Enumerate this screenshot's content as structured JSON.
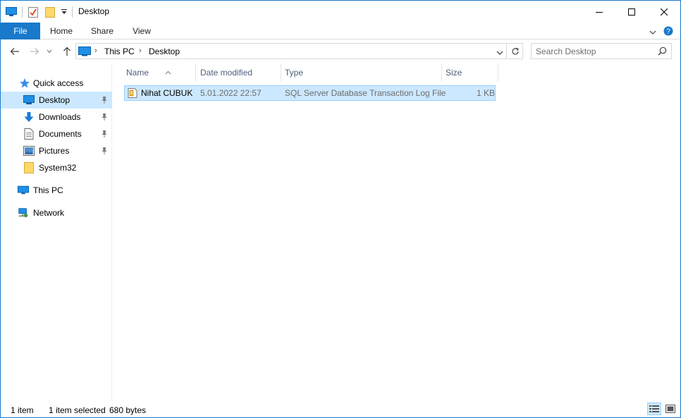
{
  "window": {
    "title": "Desktop",
    "accent": "#1979ca",
    "selection_color": "#cce8ff"
  },
  "quick_access_toolbar": {
    "icons": [
      "pc-icon",
      "properties-icon",
      "new-folder-icon",
      "customize-dropdown-icon"
    ]
  },
  "caption_buttons": [
    "minimize",
    "maximize",
    "close"
  ],
  "ribbon": {
    "tabs": [
      {
        "label": "File"
      },
      {
        "label": "Home"
      },
      {
        "label": "Share"
      },
      {
        "label": "View"
      }
    ]
  },
  "address": {
    "breadcrumbs": [
      "This PC",
      "Desktop"
    ]
  },
  "search": {
    "placeholder": "Search Desktop"
  },
  "nav": {
    "quick_access": "Quick access",
    "items": [
      {
        "label": "Desktop",
        "icon": "desktop-icon",
        "pinned": true,
        "selected": true
      },
      {
        "label": "Downloads",
        "icon": "downloads-icon",
        "pinned": true
      },
      {
        "label": "Documents",
        "icon": "documents-icon",
        "pinned": true
      },
      {
        "label": "Pictures",
        "icon": "pictures-icon",
        "pinned": true
      },
      {
        "label": "System32",
        "icon": "folder-icon",
        "pinned": false
      }
    ],
    "this_pc": "This PC",
    "network": "Network"
  },
  "columns": [
    "Name",
    "Date modified",
    "Type",
    "Size"
  ],
  "files": [
    {
      "name": "Nihat CUBUK",
      "date": "5.01.2022 22:57",
      "type": "SQL Server Database Transaction Log File",
      "size": "1 KB",
      "icon": "log-file-icon"
    }
  ],
  "status": {
    "count": "1 item",
    "selected": "1 item selected",
    "size": "680 bytes"
  }
}
